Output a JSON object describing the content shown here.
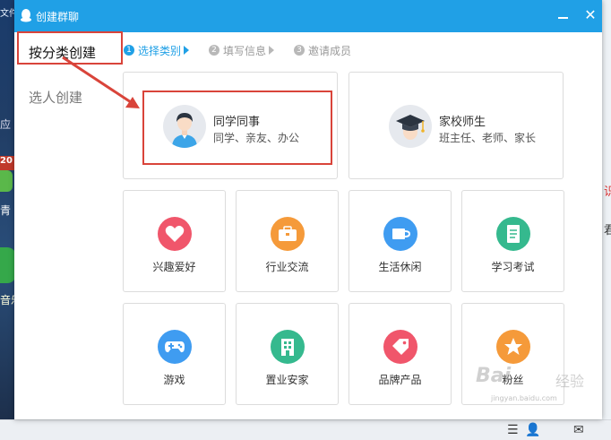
{
  "window": {
    "title": "创建群聊",
    "close_glyph": "✕"
  },
  "sidebar": {
    "items": [
      {
        "label": "按分类创建",
        "active": true
      },
      {
        "label": "选人创建",
        "active": false
      }
    ]
  },
  "steps": [
    {
      "num": "1",
      "label": "选择类别",
      "current": true
    },
    {
      "num": "2",
      "label": "填写信息",
      "current": false
    },
    {
      "num": "3",
      "label": "邀请成员",
      "current": false
    }
  ],
  "big_cards": [
    {
      "title": "同学同事",
      "subtitle": "同学、亲友、办公",
      "icon": "student-avatar-icon"
    },
    {
      "title": "家校师生",
      "subtitle": "班主任、老师、家长",
      "icon": "graduation-cap-icon"
    }
  ],
  "small_cards": [
    {
      "label": "兴趣爱好",
      "icon": "heart-icon",
      "color": "#f0566b"
    },
    {
      "label": "行业交流",
      "icon": "briefcase-icon",
      "color": "#f59a3a"
    },
    {
      "label": "生活休闲",
      "icon": "coffee-cup-icon",
      "color": "#3f9cf1"
    },
    {
      "label": "学习考试",
      "icon": "notebook-icon",
      "color": "#35b98e"
    },
    {
      "label": "游戏",
      "icon": "gamepad-icon",
      "color": "#3f9cf1"
    },
    {
      "label": "置业安家",
      "icon": "building-icon",
      "color": "#35b98e"
    },
    {
      "label": "品牌产品",
      "icon": "price-tag-icon",
      "color": "#f0566b"
    },
    {
      "label": "粉丝",
      "icon": "star-icon",
      "color": "#f59a3a"
    }
  ],
  "watermark": {
    "brand": "Bai",
    "suffix": "经验",
    "url": "jingyan.baidu.com"
  },
  "desktop_slivers": [
    "文件",
    "应",
    "20",
    "青",
    "音乐"
  ],
  "right_edge_slivers": [
    "识",
    "君"
  ],
  "colors": {
    "titlebar": "#20a0e6",
    "highlight": "#d9443a",
    "accent": "#20a0e6"
  }
}
